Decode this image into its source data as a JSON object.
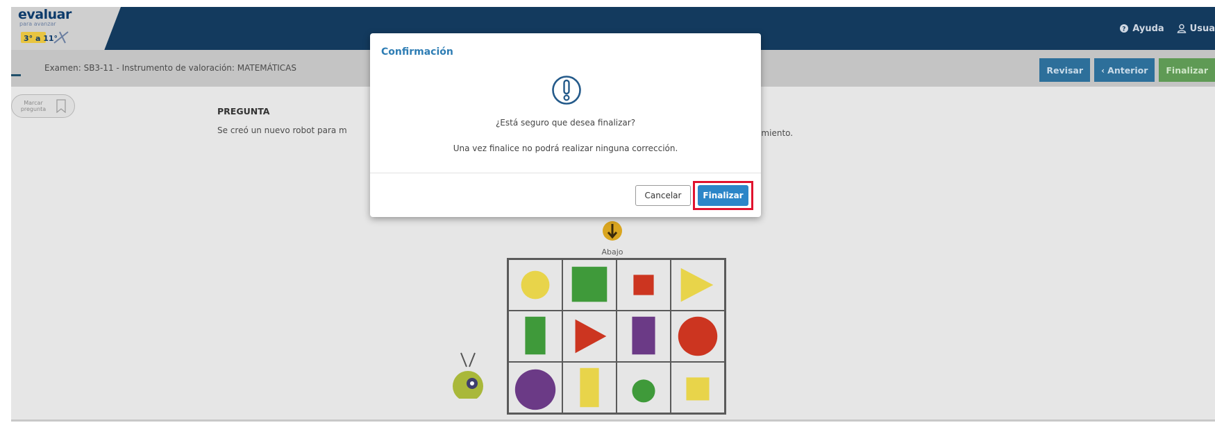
{
  "app": {
    "logo_text": "evaluar",
    "logo_sub": "para avanzar",
    "logo_badge": "3° a 11°"
  },
  "header": {
    "links": [
      {
        "label": "Ayuda",
        "icon": "help-circle-icon"
      },
      {
        "label": "Usua",
        "icon": "user-icon"
      }
    ]
  },
  "exam": {
    "title": "Examen: SB3-11 - Instrumento de valoración: MATEMÁTICAS"
  },
  "actions": {
    "review": "Revisar",
    "previous": "Anterior",
    "finish": "Finalizar"
  },
  "mark_question": {
    "label": "Marcar pregunta",
    "icon": "bookmark-icon"
  },
  "question": {
    "heading": "PREGUNTA",
    "text_start": "Se creó un nuevo robot para m",
    "text_end": "vimiento."
  },
  "figure": {
    "direction_label": "Abajo",
    "grid_cells": [
      {
        "shape": "circle",
        "color": "#e8d44a"
      },
      {
        "shape": "square",
        "color": "#3f9a3a"
      },
      {
        "shape": "small-square",
        "color": "#cc3520"
      },
      {
        "shape": "triangle-right",
        "color": "#e8d44a"
      },
      {
        "shape": "rectangle",
        "color": "#3f9a3a"
      },
      {
        "shape": "triangle-right",
        "color": "#cc3520"
      },
      {
        "shape": "rectangle",
        "color": "#6b3a86"
      },
      {
        "shape": "circle",
        "color": "#cc3520"
      },
      {
        "shape": "circle",
        "color": "#6b3a86"
      },
      {
        "shape": "rectangle",
        "color": "#e8d44a"
      },
      {
        "shape": "small-circle",
        "color": "#3f9a3a"
      },
      {
        "shape": "small-square",
        "color": "#e8d44a"
      }
    ]
  },
  "modal": {
    "title": "Confirmación",
    "icon": "exclamation-circle-icon",
    "question": "¿Está seguro que desea finalizar?",
    "note": "Una vez finalice no podrá realizar ninguna corrección.",
    "cancel": "Cancelar",
    "confirm": "Finalizar"
  },
  "colors": {
    "header_bg": "#133a5e",
    "accent_blue": "#2c86c8",
    "accent_green": "#5f9a55",
    "highlight_red": "#e0132e"
  }
}
